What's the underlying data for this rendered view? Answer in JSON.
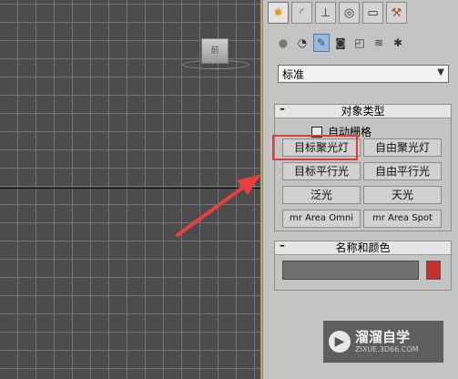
{
  "viewport": {
    "viewcube_label": "前"
  },
  "command_panel": {
    "tabs": [
      {
        "icon": "create-icon",
        "glyph": "✸"
      },
      {
        "icon": "modify-icon",
        "glyph": "◜"
      },
      {
        "icon": "hierarchy-icon",
        "glyph": "⊥"
      },
      {
        "icon": "motion-icon",
        "glyph": "◎"
      },
      {
        "icon": "display-icon",
        "glyph": "▭"
      },
      {
        "icon": "utilities-icon",
        "glyph": "⚒"
      }
    ],
    "subtypes": [
      {
        "icon": "geometry-icon",
        "glyph": "●"
      },
      {
        "icon": "shapes-icon",
        "glyph": "◔"
      },
      {
        "icon": "lights-icon",
        "glyph": "✎"
      },
      {
        "icon": "cameras-icon",
        "glyph": "◙"
      },
      {
        "icon": "helpers-icon",
        "glyph": "◰"
      },
      {
        "icon": "space-warps-icon",
        "glyph": "≋"
      },
      {
        "icon": "systems-icon",
        "glyph": "✱"
      }
    ],
    "category_dropdown": "标准",
    "object_type": {
      "title": "对象类型",
      "collapse": "–",
      "autogrid_label": "自动栅格",
      "buttons": [
        "目标聚光灯",
        "自由聚光灯",
        "目标平行光",
        "自由平行光",
        "泛光",
        "天光",
        "mr Area Omni",
        "mr Area Spot"
      ]
    },
    "name_color": {
      "title": "名称和颜色",
      "collapse": "–",
      "name_value": "",
      "swatch_color": "#c8302d"
    }
  },
  "watermark": {
    "title": "溜溜自学",
    "subtitle": "ZIXUE.3D66.COM"
  },
  "colors": {
    "highlight": "#e23a3a",
    "arrow": "#e84040"
  }
}
